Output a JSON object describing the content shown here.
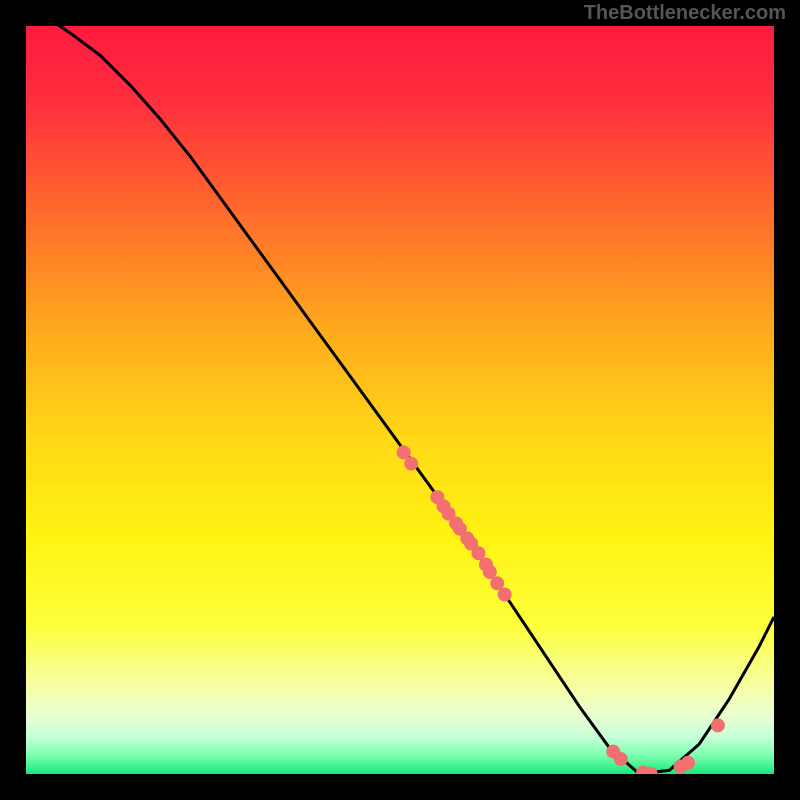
{
  "watermark": "TheBottlenecker.com",
  "chart_data": {
    "type": "line",
    "title": "",
    "xlabel": "",
    "ylabel": "",
    "xlim": [
      0,
      100
    ],
    "ylim": [
      0,
      100
    ],
    "curve": {
      "x": [
        0,
        3,
        6,
        10,
        14,
        18,
        22,
        26,
        30,
        34,
        38,
        42,
        46,
        50,
        54,
        58,
        62,
        66,
        70,
        74,
        78,
        82,
        86,
        90,
        94,
        98,
        100
      ],
      "y": [
        103,
        101,
        99,
        96,
        92,
        87.5,
        82.5,
        77,
        71.5,
        66,
        60.5,
        55,
        49.5,
        44,
        38.5,
        33,
        27,
        21,
        15,
        9,
        3.5,
        0,
        0.5,
        4,
        10,
        17,
        21
      ]
    },
    "scatter_points": [
      {
        "x": 50.5,
        "y": 43.0
      },
      {
        "x": 51.5,
        "y": 41.5
      },
      {
        "x": 55.0,
        "y": 37.0
      },
      {
        "x": 55.8,
        "y": 35.8
      },
      {
        "x": 56.5,
        "y": 34.8
      },
      {
        "x": 57.5,
        "y": 33.5
      },
      {
        "x": 58.0,
        "y": 32.8
      },
      {
        "x": 59.0,
        "y": 31.5
      },
      {
        "x": 59.5,
        "y": 30.8
      },
      {
        "x": 60.5,
        "y": 29.5
      },
      {
        "x": 61.5,
        "y": 28.0
      },
      {
        "x": 62.0,
        "y": 27.0
      },
      {
        "x": 63.0,
        "y": 25.5
      },
      {
        "x": 64.0,
        "y": 24.0
      },
      {
        "x": 78.5,
        "y": 3.0
      },
      {
        "x": 79.5,
        "y": 2.0
      },
      {
        "x": 82.5,
        "y": 0.2
      },
      {
        "x": 83.5,
        "y": 0.0
      },
      {
        "x": 87.5,
        "y": 1.0
      },
      {
        "x": 88.5,
        "y": 1.5
      },
      {
        "x": 92.5,
        "y": 6.5
      }
    ],
    "gradient_stops": [
      {
        "offset": 0.0,
        "color": "#ff1a3e"
      },
      {
        "offset": 0.1,
        "color": "#ff2e3e"
      },
      {
        "offset": 0.25,
        "color": "#ff6b2c"
      },
      {
        "offset": 0.4,
        "color": "#ffa81e"
      },
      {
        "offset": 0.55,
        "color": "#ffd816"
      },
      {
        "offset": 0.68,
        "color": "#fff312"
      },
      {
        "offset": 0.8,
        "color": "#fdff3a"
      },
      {
        "offset": 0.88,
        "color": "#f6ffa0"
      },
      {
        "offset": 0.92,
        "color": "#eaffd0"
      },
      {
        "offset": 0.95,
        "color": "#c8ffd8"
      },
      {
        "offset": 0.975,
        "color": "#7dffb0"
      },
      {
        "offset": 1.0,
        "color": "#18e879"
      }
    ],
    "point_color": "#f27070",
    "curve_color": "#000000"
  }
}
